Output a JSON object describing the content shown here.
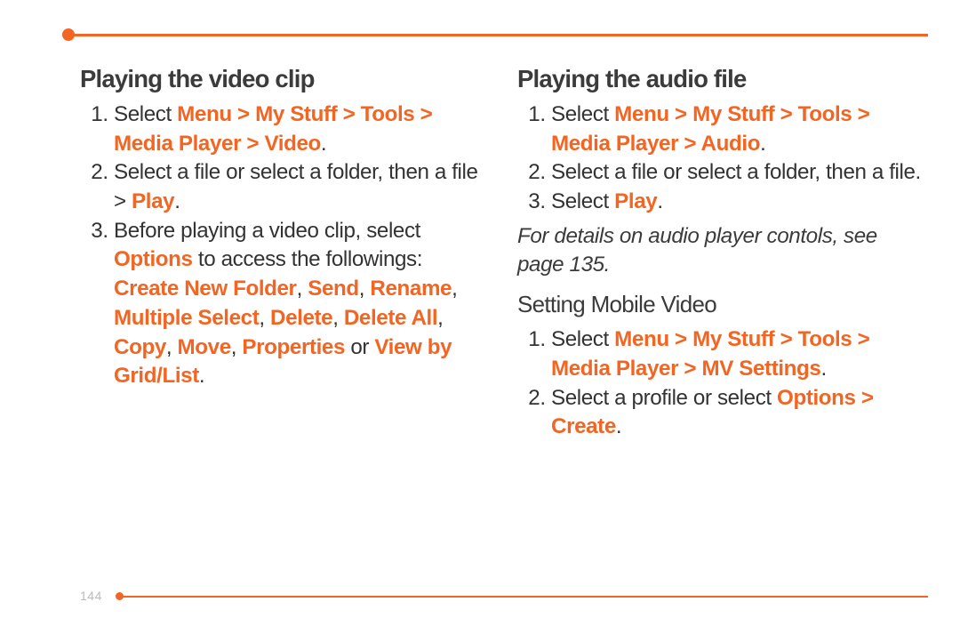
{
  "pageNumber": "144",
  "left": {
    "heading": "Playing the video clip",
    "items": [
      {
        "pre": "Select ",
        "path": "Menu > My Stuff > Tools > Media Player > Video",
        "post": "."
      },
      {
        "pre": "Select a file or select a folder, then a file > ",
        "hl": "Play",
        "post": "."
      },
      {
        "pre": "Before playing a video clip, select ",
        "hl": "Options",
        "mid": " to access the followings: ",
        "opts": "Create New Folder",
        "c1": ", ",
        "o2": "Send",
        "c2": ", ",
        "o3": "Rename",
        "c3": ", ",
        "o4": "Multiple Select",
        "c4": ", ",
        "o5": "Delete",
        "c5": ", ",
        "o6": "Delete All",
        "c6": ", ",
        "o7": "Copy",
        "c7": ", ",
        "o8": "Move",
        "c8": ", ",
        "o9": "Properties",
        "c9": " or ",
        "o10": "View by Grid/List",
        "post": "."
      }
    ]
  },
  "right": {
    "heading1": "Playing the audio file",
    "items1": [
      {
        "pre": "Select ",
        "path": "Menu > My Stuff > Tools > Media Player > Audio",
        "post": "."
      },
      {
        "pre": "Select a file or select a folder, then a file.",
        "path": "",
        "post": ""
      },
      {
        "pre": "Select ",
        "hl": "Play",
        "post": "."
      }
    ],
    "note": "For details on audio player contols, see page 135.",
    "heading2": "Setting Mobile Video",
    "items2": [
      {
        "pre": "Select ",
        "path": "Menu > My Stuff > Tools > Media Player > MV Settings",
        "post": "."
      },
      {
        "pre": "Select a profile or select ",
        "hl": "Options > Create",
        "post": "."
      }
    ]
  }
}
